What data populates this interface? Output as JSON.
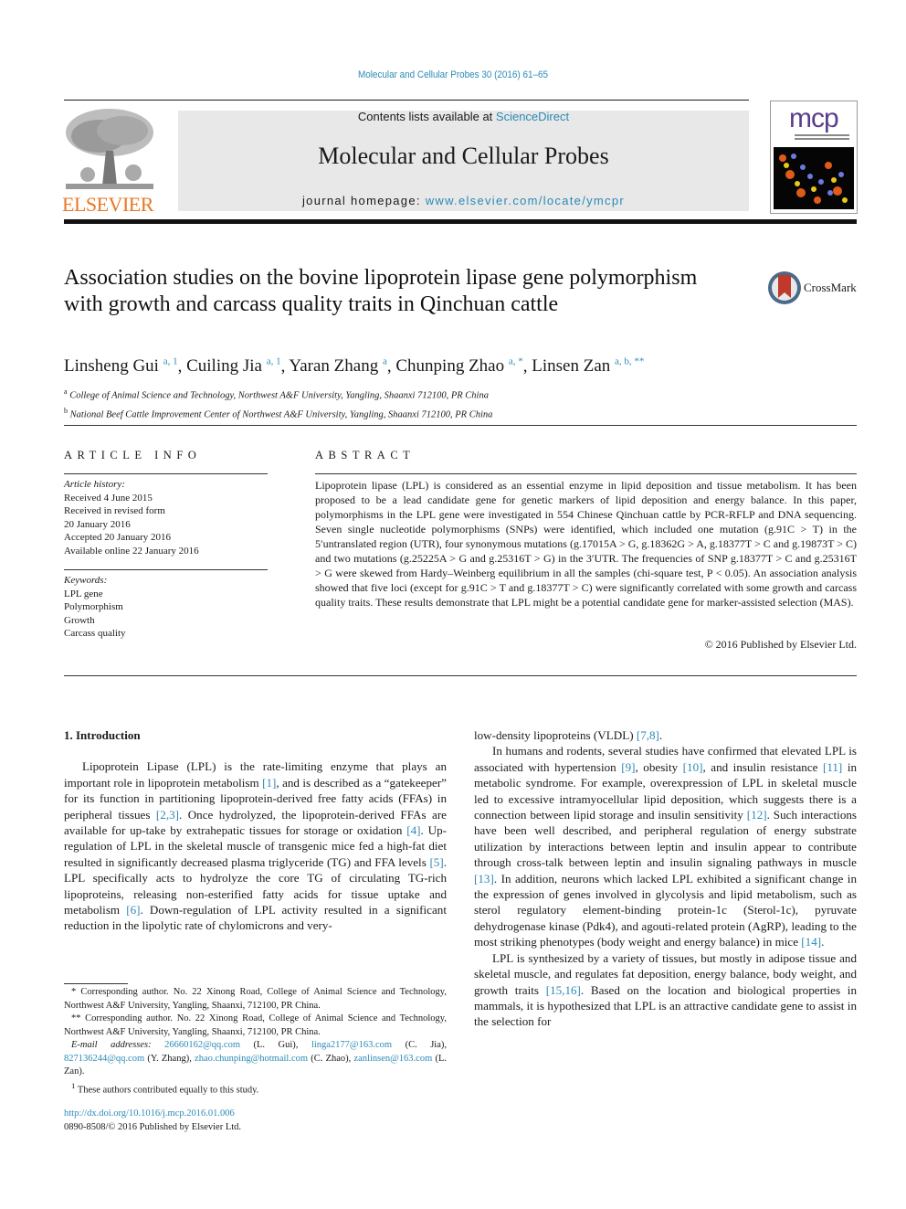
{
  "header": {
    "journal_ref": "Molecular and Cellular Probes 30 (2016) 61–65",
    "contents_prefix": "Contents lists available at ",
    "contents_link": "ScienceDirect",
    "journal_title": "Molecular and Cellular Probes",
    "homepage_prefix": "journal homepage: ",
    "homepage_link": "www.elsevier.com/locate/ymcpr",
    "publisher_logo_text": "ELSEVIER",
    "cover_logo_text": "mcp",
    "crossmark_label": "CrossMark",
    "colors": {
      "link": "#2a8ab5",
      "elsevier_orange": "#e87722",
      "header_box": "#e8e8e8"
    }
  },
  "article": {
    "title": "Association studies on the bovine lipoprotein lipase gene polymorphism with growth and carcass quality traits in Qinchuan cattle",
    "authors": [
      {
        "name": "Linsheng Gui",
        "marks": "a, 1"
      },
      {
        "name": "Cuiling Jia",
        "marks": "a, 1"
      },
      {
        "name": "Yaran Zhang",
        "marks": "a"
      },
      {
        "name": "Chunping Zhao",
        "marks": "a, *"
      },
      {
        "name": "Linsen Zan",
        "marks": "a, b, **"
      }
    ],
    "affiliations": [
      {
        "mark": "a",
        "text": "College of Animal Science and Technology, Northwest A&F University, Yangling, Shaanxi 712100, PR China"
      },
      {
        "mark": "b",
        "text": "National Beef Cattle Improvement Center of Northwest A&F University, Yangling, Shaanxi 712100, PR China"
      }
    ]
  },
  "article_info": {
    "heading": "ARTICLE INFO",
    "history_label": "Article history:",
    "history": [
      "Received 4 June 2015",
      "Received in revised form",
      "20 January 2016",
      "Accepted 20 January 2016",
      "Available online 22 January 2016"
    ],
    "keywords_label": "Keywords:",
    "keywords": [
      "LPL gene",
      "Polymorphism",
      "Growth",
      "Carcass quality"
    ]
  },
  "abstract": {
    "heading": "ABSTRACT",
    "text": "Lipoprotein lipase (LPL) is considered as an essential enzyme in lipid deposition and tissue metabolism. It has been proposed to be a lead candidate gene for genetic markers of lipid deposition and energy balance. In this paper, polymorphisms in the LPL gene were investigated in 554 Chinese Qinchuan cattle by PCR-RFLP and DNA sequencing. Seven single nucleotide polymorphisms (SNPs) were identified, which included one mutation (g.91C > T) in the 5′untranslated region (UTR), four synonymous mutations (g.17015A > G, g.18362G > A, g.18377T > C and g.19873T > C) and two mutations (g.25225A > G and g.25316T > G) in the 3′UTR. The frequencies of SNP g.18377T > C and g.25316T > G were skewed from Hardy–Weinberg equilibrium in all the samples (chi-square test, P < 0.05). An association analysis showed that five loci (except for g.91C > T and g.18377T > C) were significantly correlated with some growth and carcass quality traits. These results demonstrate that LPL might be a potential candidate gene for marker-assisted selection (MAS).",
    "copyright": "© 2016 Published by Elsevier Ltd."
  },
  "body": {
    "section_title": "1.  Introduction",
    "left_paragraph": [
      {
        "t": "Lipoprotein Lipase (LPL) is the rate-limiting enzyme that plays an important role in lipoprotein metabolism "
      },
      {
        "ref": "[1]"
      },
      {
        "t": ", and is described as a “gatekeeper” for its function in partitioning lipoprotein-derived free fatty acids (FFAs) in peripheral tissues "
      },
      {
        "ref": "[2,3]"
      },
      {
        "t": ". Once hydrolyzed, the lipoprotein-derived FFAs are available for up-take by extrahepatic tissues for storage or oxidation "
      },
      {
        "ref": "[4]"
      },
      {
        "t": ". Up-regulation of LPL in the skeletal muscle of transgenic mice fed a high-fat diet resulted in significantly decreased plasma triglyceride (TG) and FFA levels "
      },
      {
        "ref": "[5]"
      },
      {
        "t": ". LPL specifically acts to hydrolyze the core TG of circulating TG-rich lipoproteins, releasing non-esterified fatty acids for tissue uptake and metabolism "
      },
      {
        "ref": "[6]"
      },
      {
        "t": ". Down-regulation of LPL activity resulted in a significant reduction in the lipolytic rate of chylomicrons and very-"
      }
    ],
    "right_paragraphs": [
      [
        {
          "t": "low-density lipoproteins (VLDL) "
        },
        {
          "ref": "[7,8]"
        },
        {
          "t": "."
        }
      ],
      [
        {
          "t": "In humans and rodents, several studies have confirmed that elevated LPL is associated with hypertension "
        },
        {
          "ref": "[9]"
        },
        {
          "t": ", obesity "
        },
        {
          "ref": "[10]"
        },
        {
          "t": ", and insulin resistance "
        },
        {
          "ref": "[11]"
        },
        {
          "t": " in metabolic syndrome. For example, overexpression of LPL in skeletal muscle led to excessive intramyocellular lipid deposition, which suggests there is a connection between lipid storage and insulin sensitivity "
        },
        {
          "ref": "[12]"
        },
        {
          "t": ". Such interactions have been well described, and peripheral regulation of energy substrate utilization by interactions between leptin and insulin appear to contribute through cross-talk between leptin and insulin signaling pathways in muscle "
        },
        {
          "ref": "[13]"
        },
        {
          "t": ". In addition, neurons which lacked LPL exhibited a significant change in the expression of genes involved in glycolysis and lipid metabolism, such as sterol regulatory element-binding protein-1c (Sterol-1c), pyruvate dehydrogenase kinase (Pdk4), and agouti-related protein (AgRP), leading to the most striking phenotypes (body weight and energy balance) in mice "
        },
        {
          "ref": "[14]"
        },
        {
          "t": "."
        }
      ],
      [
        {
          "t": "LPL is synthesized by a variety of tissues, but mostly in adipose tissue and skeletal muscle, and regulates fat deposition, energy balance, body weight, and growth traits "
        },
        {
          "ref": "[15,16]"
        },
        {
          "t": ". Based on the location and biological properties in mammals, it is hypothesized that LPL is an attractive candidate gene to assist in the selection for"
        }
      ]
    ]
  },
  "footnotes": {
    "corr1": "* Corresponding author. No. 22 Xinong Road, College of Animal Science and Technology, Northwest A&F University, Yangling, Shaanxi, 712100, PR China.",
    "corr2": "** Corresponding author. No. 22 Xinong Road, College of Animal Science and Technology, Northwest A&F University, Yangling, Shaanxi, 712100, PR China.",
    "email_label": "E-mail addresses:",
    "emails": [
      {
        "addr": "26660162@qq.com",
        "who": " (L. Gui), "
      },
      {
        "addr": "linga2177@163.com",
        "who": " (C. Jia), "
      },
      {
        "addr": "827136244@qq.com",
        "who": " (Y. Zhang), "
      },
      {
        "addr": "zhao.chunping@hotmail.com",
        "who": " (C. Zhao), "
      },
      {
        "addr": "zanlinsen@163.com",
        "who": " (L. Zan)."
      }
    ],
    "equal_mark": "1",
    "equal": "These authors contributed equally to this study.",
    "doi": "http://dx.doi.org/10.1016/j.mcp.2016.01.006",
    "issn": "0890-8508/© 2016 Published by Elsevier Ltd."
  }
}
